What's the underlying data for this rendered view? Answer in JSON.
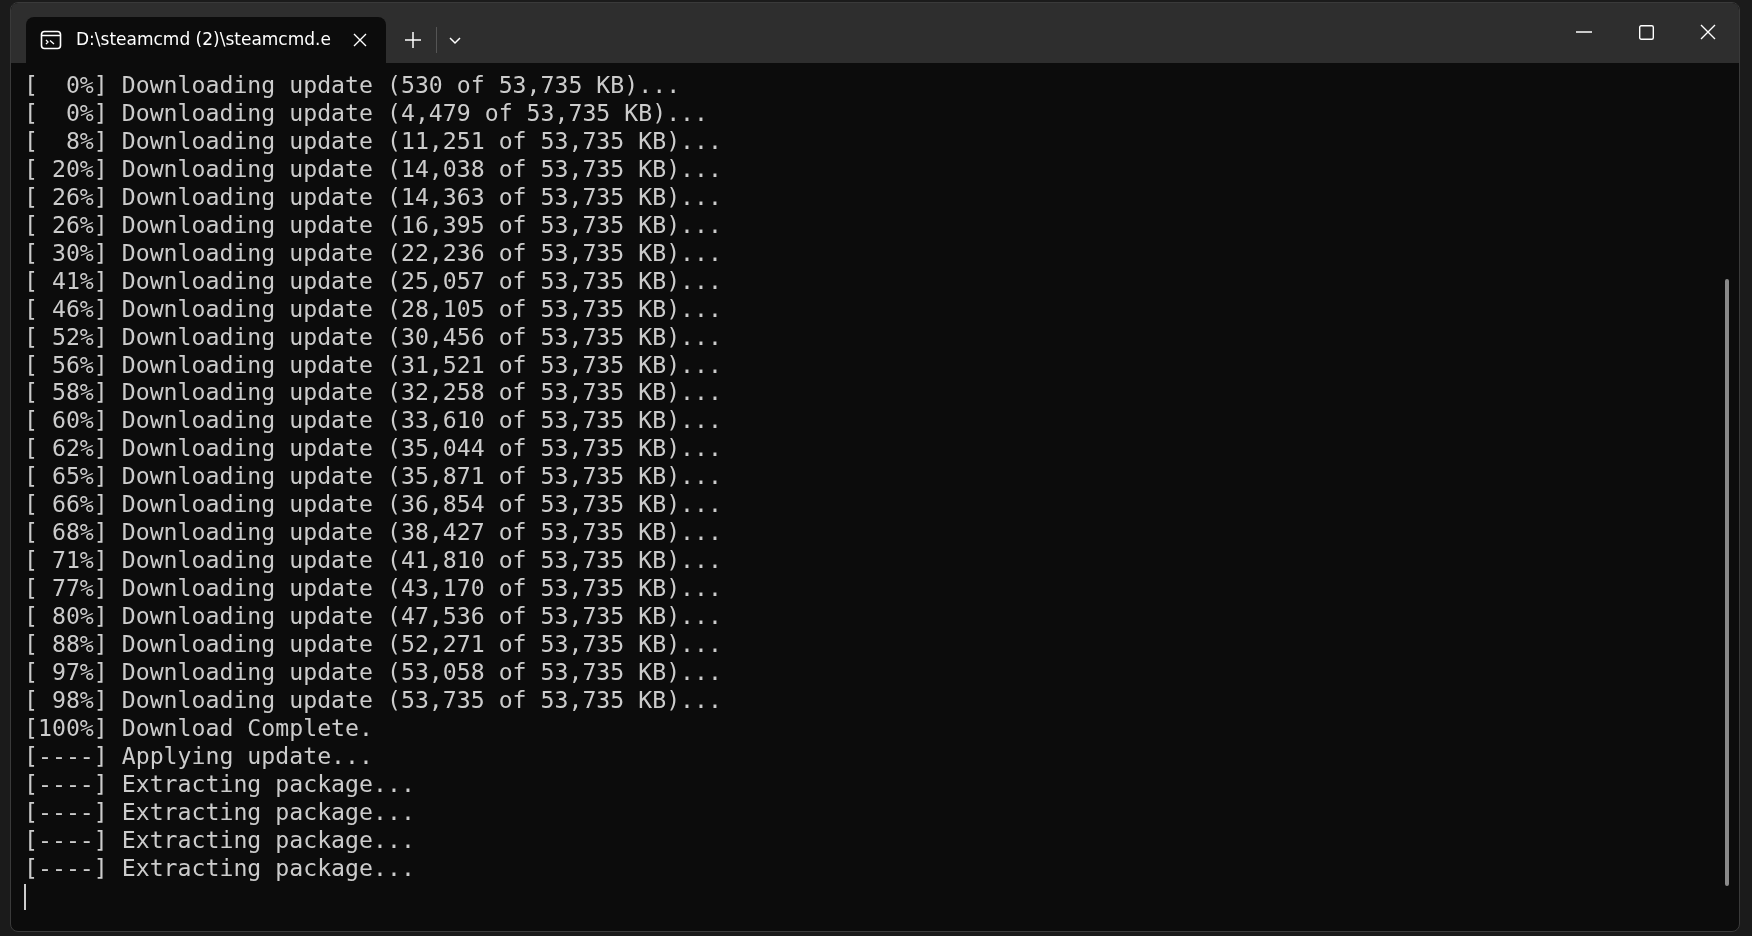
{
  "window": {
    "tab": {
      "title": "D:\\steamcmd (2)\\steamcmd.e",
      "selected": true
    }
  },
  "console": {
    "lines": [
      "[  0%] Downloading update (530 of 53,735 KB)...",
      "[  0%] Downloading update (4,479 of 53,735 KB)...",
      "[  8%] Downloading update (11,251 of 53,735 KB)...",
      "[ 20%] Downloading update (14,038 of 53,735 KB)...",
      "[ 26%] Downloading update (14,363 of 53,735 KB)...",
      "[ 26%] Downloading update (16,395 of 53,735 KB)...",
      "[ 30%] Downloading update (22,236 of 53,735 KB)...",
      "[ 41%] Downloading update (25,057 of 53,735 KB)...",
      "[ 46%] Downloading update (28,105 of 53,735 KB)...",
      "[ 52%] Downloading update (30,456 of 53,735 KB)...",
      "[ 56%] Downloading update (31,521 of 53,735 KB)...",
      "[ 58%] Downloading update (32,258 of 53,735 KB)...",
      "[ 60%] Downloading update (33,610 of 53,735 KB)...",
      "[ 62%] Downloading update (35,044 of 53,735 KB)...",
      "[ 65%] Downloading update (35,871 of 53,735 KB)...",
      "[ 66%] Downloading update (36,854 of 53,735 KB)...",
      "[ 68%] Downloading update (38,427 of 53,735 KB)...",
      "[ 71%] Downloading update (41,810 of 53,735 KB)...",
      "[ 77%] Downloading update (43,170 of 53,735 KB)...",
      "[ 80%] Downloading update (47,536 of 53,735 KB)...",
      "[ 88%] Downloading update (52,271 of 53,735 KB)...",
      "[ 97%] Downloading update (53,058 of 53,735 KB)...",
      "[ 98%] Downloading update (53,735 of 53,735 KB)...",
      "[100%] Download Complete.",
      "[----] Applying update...",
      "[----] Extracting package...",
      "[----] Extracting package...",
      "[----] Extracting package...",
      "[----] Extracting package..."
    ]
  }
}
